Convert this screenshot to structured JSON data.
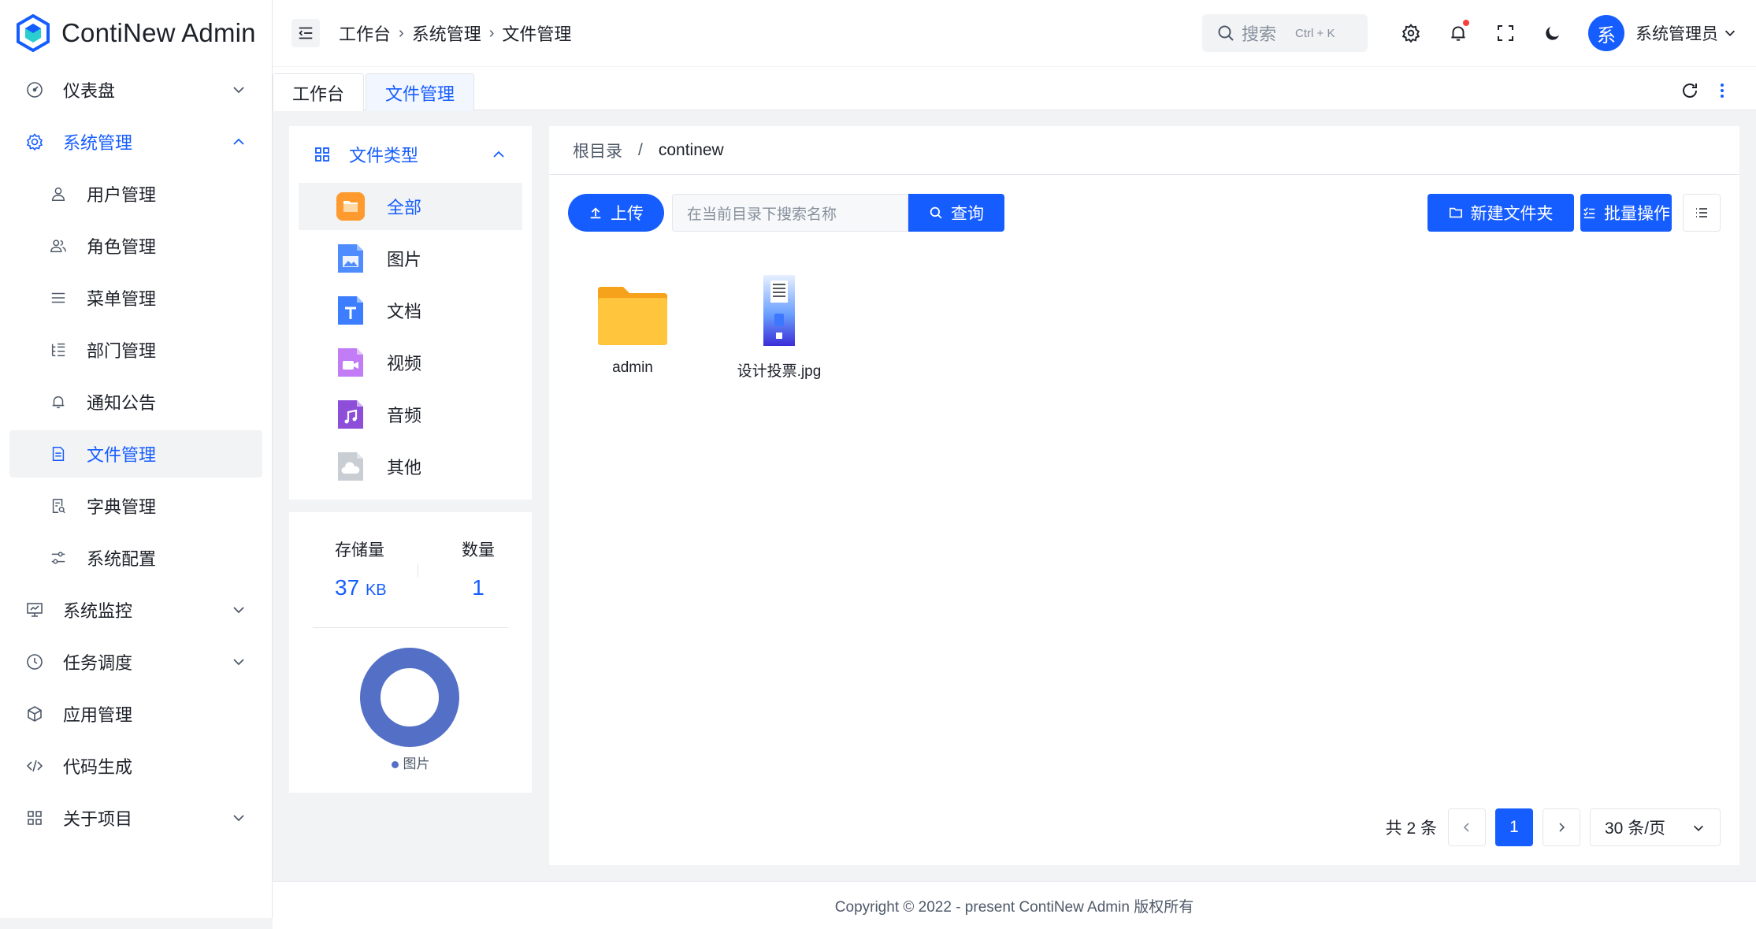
{
  "app": {
    "title": "ContiNew Admin"
  },
  "sidebar": {
    "items": [
      {
        "label": "仪表盘",
        "icon": "dashboard-icon",
        "expandable": true
      },
      {
        "label": "系统管理",
        "icon": "settings-icon",
        "expandable": true,
        "open": true
      },
      {
        "label": "用户管理",
        "icon": "user-icon"
      },
      {
        "label": "角色管理",
        "icon": "user-group-icon"
      },
      {
        "label": "菜单管理",
        "icon": "menu-icon"
      },
      {
        "label": "部门管理",
        "icon": "department-icon"
      },
      {
        "label": "通知公告",
        "icon": "bell-icon"
      },
      {
        "label": "文件管理",
        "icon": "file-icon",
        "active": true
      },
      {
        "label": "字典管理",
        "icon": "dictionary-icon"
      },
      {
        "label": "系统配置",
        "icon": "config-icon"
      },
      {
        "label": "系统监控",
        "icon": "monitor-icon",
        "expandable": true
      },
      {
        "label": "任务调度",
        "icon": "clock-icon",
        "expandable": true
      },
      {
        "label": "应用管理",
        "icon": "app-icon"
      },
      {
        "label": "代码生成",
        "icon": "code-icon"
      },
      {
        "label": "关于项目",
        "icon": "apps-icon",
        "expandable": true
      }
    ]
  },
  "header": {
    "breadcrumb": [
      "工作台",
      "系统管理",
      "文件管理"
    ],
    "search": {
      "placeholder": "搜索",
      "shortcut": "Ctrl + K"
    },
    "user": {
      "avatar_text": "系",
      "name": "系统管理员"
    },
    "notification_dot_color": "#f53f3f"
  },
  "tabs": [
    {
      "label": "工作台"
    },
    {
      "label": "文件管理",
      "active": true
    }
  ],
  "file_types": {
    "title": "文件类型",
    "items": [
      {
        "label": "全部",
        "icon": "folder-icon",
        "color": "#ff9a2e",
        "active": true
      },
      {
        "label": "图片",
        "icon": "image-icon",
        "color": "#3c7eff"
      },
      {
        "label": "文档",
        "icon": "document-icon",
        "color": "#3c7eff"
      },
      {
        "label": "视频",
        "icon": "video-icon",
        "color": "#b56cf0"
      },
      {
        "label": "音频",
        "icon": "audio-icon",
        "color": "#8d4eda"
      },
      {
        "label": "其他",
        "icon": "cloud-icon",
        "color": "#c9cdd4"
      }
    ]
  },
  "stats": {
    "storage_label": "存储量",
    "storage_value": "37",
    "storage_unit": "KB",
    "count_label": "数量",
    "count_value": "1",
    "legend": "图片",
    "legend_color": "#5470c6"
  },
  "chart_data": {
    "type": "pie",
    "categories": [
      "图片"
    ],
    "values": [
      1
    ],
    "title": "",
    "colors": [
      "#5470c6"
    ]
  },
  "main": {
    "path": {
      "root": "根目录",
      "current": "continew"
    },
    "upload_label": "上传",
    "search_placeholder": "在当前目录下搜索名称",
    "query_label": "查询",
    "new_folder_label": "新建文件夹",
    "batch_label": "批量操作",
    "files": [
      {
        "name": "admin",
        "type": "folder"
      },
      {
        "name": "设计投票.jpg",
        "type": "image"
      }
    ]
  },
  "pagination": {
    "total_text": "共 2 条",
    "current_page": "1",
    "page_size": "30 条/页"
  },
  "footer": {
    "text": "Copyright © 2022 - present ContiNew Admin 版权所有"
  },
  "colors": {
    "primary": "#165dff",
    "background": "#f2f3f5",
    "text": "#1d2129"
  }
}
